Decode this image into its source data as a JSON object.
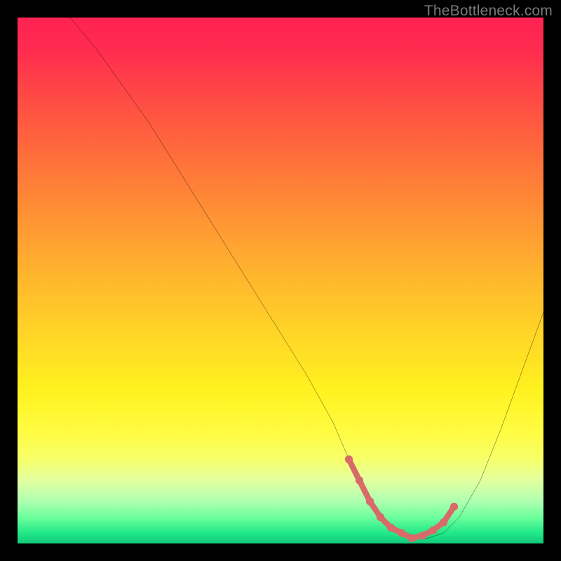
{
  "watermark": "TheBottleneck.com",
  "chart_data": {
    "type": "line",
    "title": "",
    "xlabel": "",
    "ylabel": "",
    "xlim": [
      0,
      100
    ],
    "ylim": [
      0,
      100
    ],
    "series": [
      {
        "name": "curve",
        "x": [
          10,
          15,
          20,
          25,
          30,
          35,
          40,
          45,
          50,
          55,
          60,
          63,
          66,
          69,
          72,
          75,
          78,
          81,
          84,
          88,
          92,
          96,
          100
        ],
        "y": [
          100,
          94,
          87,
          80,
          72,
          64,
          56,
          48,
          40,
          32,
          23,
          16,
          10,
          5,
          2,
          1,
          1,
          2,
          5,
          12,
          22,
          33,
          44
        ],
        "color": "#000000"
      }
    ],
    "highlight": {
      "name": "optimal-zone",
      "color": "#d86a6a",
      "points_x": [
        63,
        65,
        67,
        69,
        71,
        73,
        75,
        77,
        79,
        81,
        83
      ],
      "points_y": [
        16,
        12,
        8,
        5,
        3,
        2,
        1,
        1.5,
        2.5,
        4,
        7
      ]
    },
    "gradient_stops": [
      {
        "pos": 0,
        "color": "#ff2353"
      },
      {
        "pos": 50,
        "color": "#ffc028"
      },
      {
        "pos": 80,
        "color": "#fffc43"
      },
      {
        "pos": 100,
        "color": "#12c97b"
      }
    ]
  }
}
